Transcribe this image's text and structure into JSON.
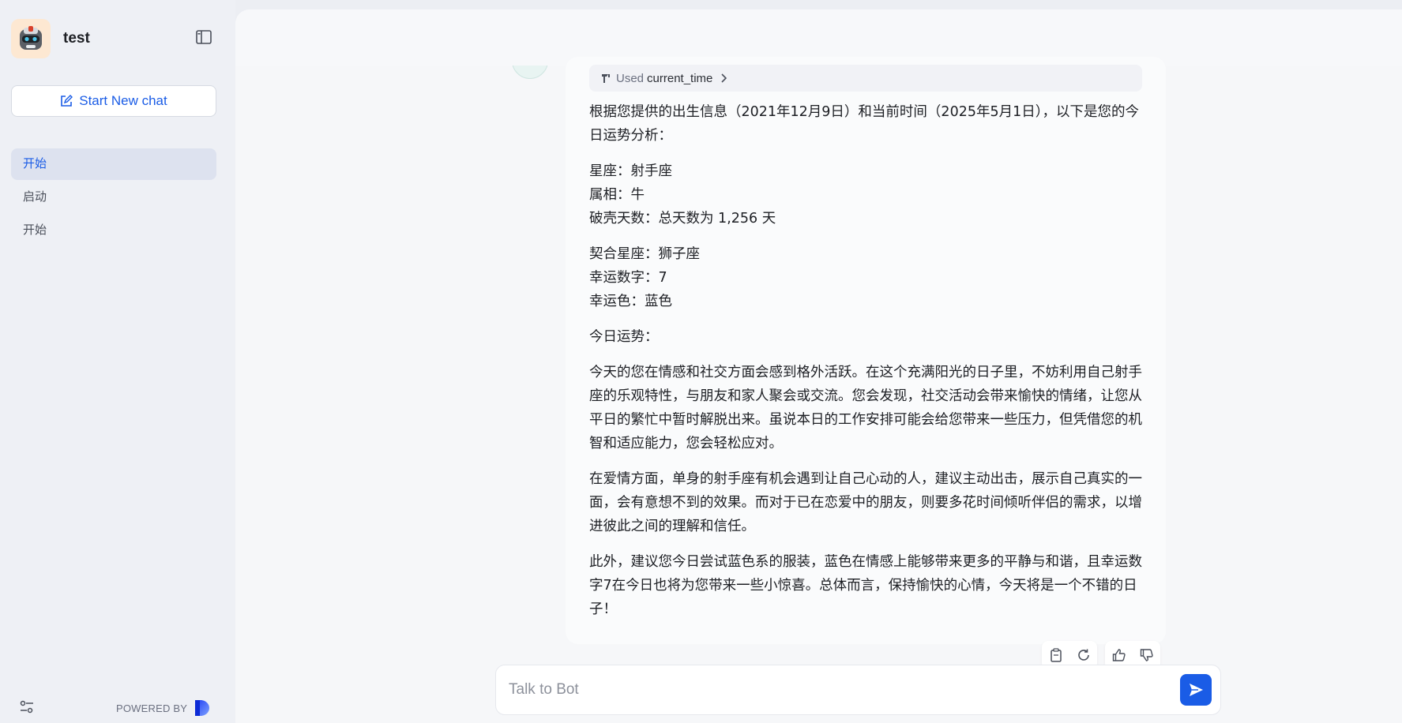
{
  "sidebar": {
    "bot_name": "test",
    "new_chat_label": "Start New chat",
    "conversations": [
      {
        "label": "开始",
        "active": true
      },
      {
        "label": "启动",
        "active": false
      },
      {
        "label": "开始",
        "active": false
      }
    ],
    "powered_by": "POWERED BY"
  },
  "message": {
    "tool_used_prefix": "Used",
    "tool_name": "current_time",
    "paragraphs": [
      "根据您提供的出生信息（2021年12月9日）和当前时间（2025年5月1日），以下是您的今日运势分析：",
      "星座：射手座\n属相：牛\n破壳天数：总天数为 1,256 天",
      "契合星座：狮子座\n幸运数字：7\n幸运色：蓝色",
      "今日运势：",
      "今天的您在情感和社交方面会感到格外活跃。在这个充满阳光的日子里，不妨利用自己射手座的乐观特性，与朋友和家人聚会或交流。您会发现，社交活动会带来愉快的情绪，让您从平日的繁忙中暂时解脱出来。虽说本日的工作安排可能会给您带来一些压力，但凭借您的机智和适应能力，您会轻松应对。",
      "在爱情方面，单身的射手座有机会遇到让自己心动的人，建议主动出击，展示自己真实的一面，会有意想不到的效果。而对于已在恋爱中的朋友，则要多花时间倾听伴侣的需求，以增进彼此之间的理解和信任。",
      "此外，建议您今日尝试蓝色系的服装，蓝色在情感上能够带来更多的平静与和谐，且幸运数字7在今日也将为您带来一些小惊喜。总体而言，保持愉快的心情，今天将是一个不错的日子！"
    ]
  },
  "composer": {
    "placeholder": "Talk to Bot",
    "value": ""
  },
  "colors": {
    "accent": "#1a5ce6",
    "sidebar_bg": "#eef0f5",
    "active_item_bg": "#dde2ef"
  },
  "icons": [
    "bot-avatar-icon",
    "sidebar-collapse-icon",
    "edit-icon",
    "settings-sliders-icon",
    "coze-logo-icon",
    "tool-icon",
    "chevron-right-icon",
    "copy-icon",
    "regenerate-icon",
    "thumbs-up-icon",
    "thumbs-down-icon",
    "send-icon"
  ]
}
